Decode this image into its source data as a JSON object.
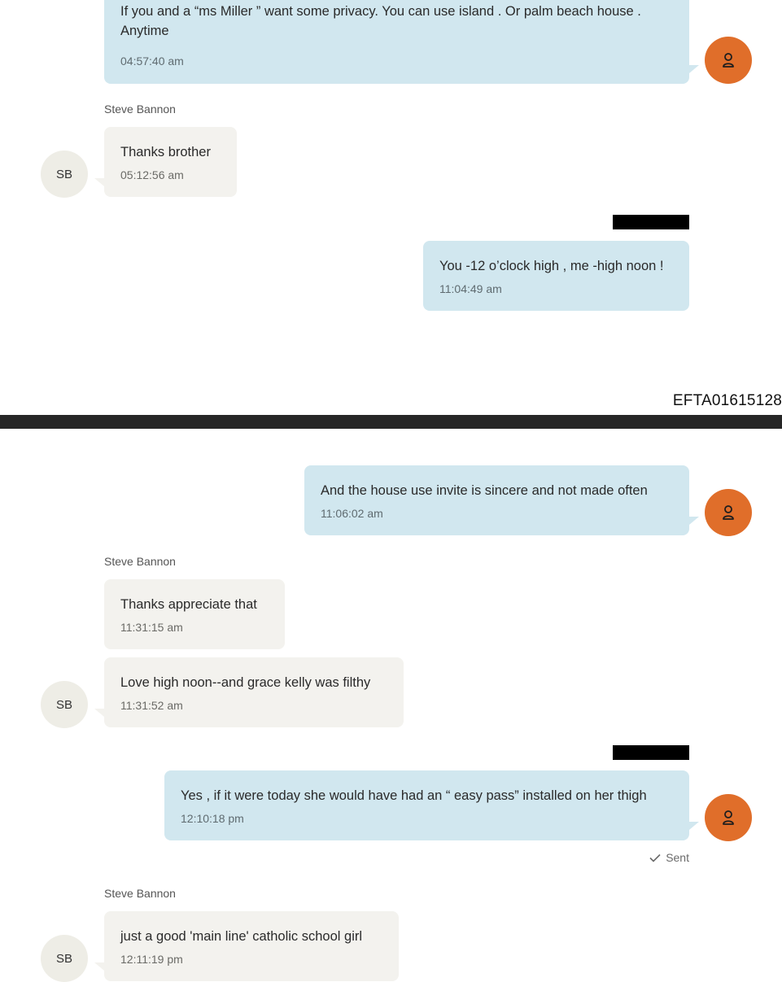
{
  "colors": {
    "outgoing_bubble": "#d1e7ef",
    "incoming_bubble": "#f3f2ee",
    "my_avatar": "#e06e2a",
    "contact_avatar": "#eeede6",
    "separator": "#262626",
    "redaction": "#000000"
  },
  "contact": {
    "name": "Steve Bannon",
    "initials": "SB"
  },
  "my_avatar_icon": "person-icon",
  "bates_number": "EFTA01615128",
  "page1": {
    "messages": [
      {
        "direction": "outgoing",
        "text_line1": "If you and a “ms Miller ” want some privacy. You can use island . Or palm beach house .",
        "text_line2": "Anytime",
        "time": "04:57:40 am"
      },
      {
        "direction": "incoming",
        "sender": "Steve Bannon",
        "text": "Thanks brother",
        "time": "05:12:56 am"
      },
      {
        "direction": "outgoing",
        "text": "You -12 o’clock high , me -high noon !",
        "time": "11:04:49 am"
      }
    ]
  },
  "page2": {
    "messages": [
      {
        "direction": "outgoing",
        "text": "And the house use invite is sincere and not made often",
        "time": "11:06:02 am"
      },
      {
        "direction": "incoming",
        "sender": "Steve Bannon",
        "text": "Thanks appreciate that",
        "time": "11:31:15 am"
      },
      {
        "direction": "incoming",
        "text": "Love high noon--and grace kelly was filthy",
        "time": "11:31:52 am"
      },
      {
        "direction": "outgoing",
        "text": "Yes , if it were today she would have had an “ easy pass” installed on her thigh",
        "time": "12:10:18 pm",
        "status": "Sent"
      },
      {
        "direction": "incoming",
        "sender": "Steve Bannon",
        "text": "just a good 'main line' catholic school girl",
        "time": "12:11:19 pm"
      }
    ]
  }
}
